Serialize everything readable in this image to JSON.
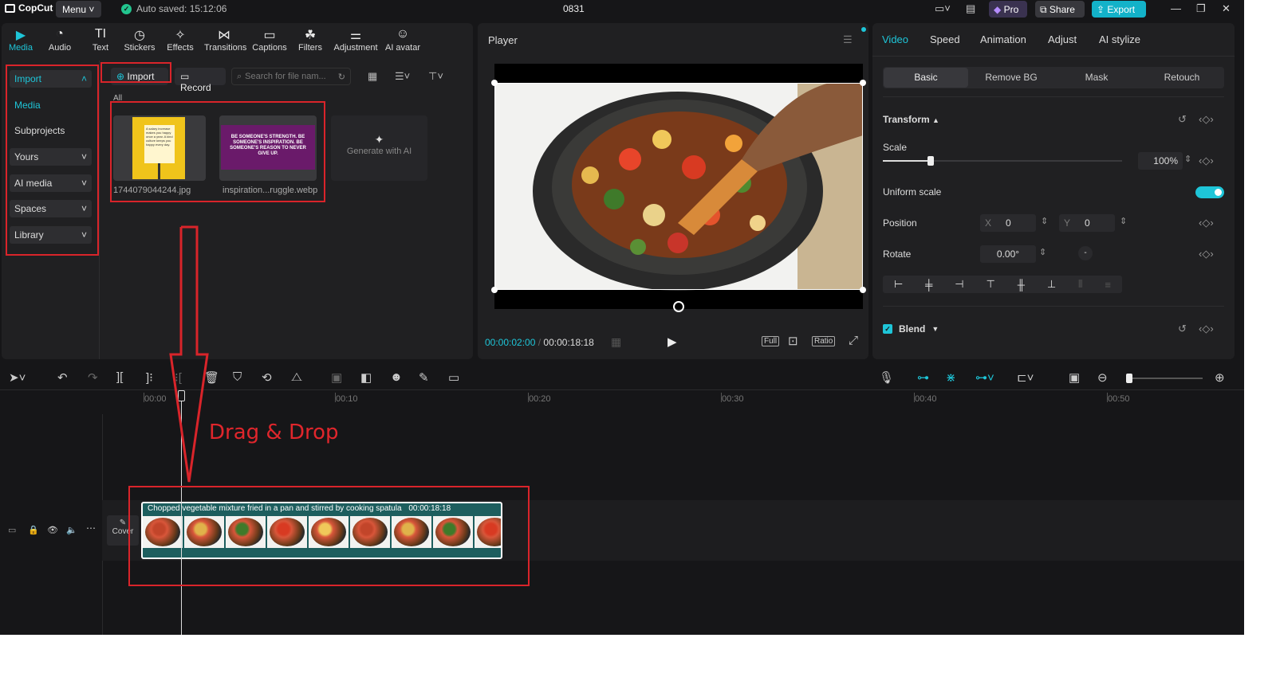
{
  "app": {
    "name": "CopCut",
    "menu_label": "Menu",
    "autosave": "Auto saved: 15:12:06",
    "project_name": "0831",
    "pro_label": "Pro",
    "share_label": "Share",
    "export_label": "Export"
  },
  "toolbar": [
    {
      "label": "Media",
      "icon": "media-icon"
    },
    {
      "label": "Audio",
      "icon": "audio-icon"
    },
    {
      "label": "Text",
      "icon": "text-icon"
    },
    {
      "label": "Stickers",
      "icon": "stickers-icon"
    },
    {
      "label": "Effects",
      "icon": "effects-icon"
    },
    {
      "label": "Transitions",
      "icon": "transitions-icon"
    },
    {
      "label": "Captions",
      "icon": "captions-icon"
    },
    {
      "label": "Filters",
      "icon": "filters-icon"
    },
    {
      "label": "Adjustment",
      "icon": "adjustment-icon"
    },
    {
      "label": "AI avatar",
      "icon": "ai-avatar-icon"
    }
  ],
  "sidebar": [
    {
      "label": "Import",
      "chevron": "˄"
    },
    {
      "label": "Media",
      "chevron": ""
    },
    {
      "label": "Subprojects",
      "chevron": ""
    },
    {
      "label": "Yours",
      "chevron": "˅"
    },
    {
      "label": "AI media",
      "chevron": "˅"
    },
    {
      "label": "Spaces",
      "chevron": "˅"
    },
    {
      "label": "Library",
      "chevron": "˅"
    }
  ],
  "media": {
    "import_label": "Import",
    "record_label": "Record",
    "search_placeholder": "Search for file nam...",
    "section_label": "All",
    "items": [
      {
        "name": "1744079044244.jpg",
        "preview_text": "A salary increase makes you happy once a year. A kind culture keeps you happy every day."
      },
      {
        "name": "inspiration...ruggle.webp",
        "preview_text": "BE SOMEONE'S STRENGTH. BE SOMEONE'S INSPIRATION. BE SOMEONE'S REASON TO NEVER GIVE UP."
      }
    ],
    "generate_label": "Generate with AI"
  },
  "player": {
    "title": "Player",
    "current_time": "00:00:02:00",
    "total_time": "00:00:18:18",
    "full_label": "Full",
    "ratio_label": "Ratio"
  },
  "properties": {
    "tabs": [
      "Video",
      "Speed",
      "Animation",
      "Adjust",
      "AI stylize"
    ],
    "subtabs": [
      "Basic",
      "Remove BG",
      "Mask",
      "Retouch"
    ],
    "transform_label": "Transform",
    "scale_label": "Scale",
    "scale_value": "100%",
    "scale_fraction": 0.2,
    "uniform_label": "Uniform scale",
    "uniform_on": true,
    "position_label": "Position",
    "x_label": "X",
    "x_value": "0",
    "y_label": "Y",
    "y_value": "0",
    "rotate_label": "Rotate",
    "rotate_value": "0.00°",
    "blend_label": "Blend"
  },
  "timeline": {
    "ruler": [
      "00:00",
      "00:10",
      "00:20",
      "00:30",
      "00:40",
      "00:50"
    ],
    "annotation": "Drag & Drop",
    "cover_label": "Cover",
    "clip_title": "Chopped vegetable mixture fried in a pan and stirred by cooking spatula",
    "clip_duration": "00:00:18:18",
    "zoom_fraction": 0.0
  },
  "colors": {
    "accent": "#1ec5d8",
    "highlight": "#d9242a",
    "clip": "#1d5e5e",
    "background": "#161618"
  }
}
